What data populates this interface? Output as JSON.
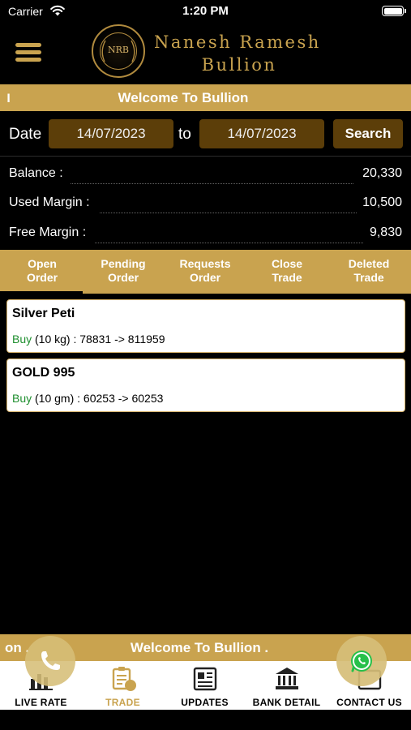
{
  "status": {
    "carrier": "Carrier",
    "time": "1:20 PM"
  },
  "brand": {
    "monogram": "NRB",
    "line1": "Nanesh Ramesh",
    "line2": "Bullion"
  },
  "ticker_top": {
    "fragment": "ו",
    "text": "Welcome To Bullion"
  },
  "filter": {
    "date_label": "Date",
    "from_date": "14/07/2023",
    "to_label": "to",
    "to_date": "14/07/2023",
    "search_label": "Search"
  },
  "account": {
    "balance_label": "Balance :",
    "balance_value": "20,330",
    "used_margin_label": "Used Margin :",
    "used_margin_value": "10,500",
    "free_margin_label": "Free Margin :",
    "free_margin_value": "9,830"
  },
  "order_tabs": [
    {
      "line1": "Open",
      "line2": "Order",
      "active": true
    },
    {
      "line1": "Pending",
      "line2": "Order"
    },
    {
      "line1": "Requests",
      "line2": "Order"
    },
    {
      "line1": "Close",
      "line2": "Trade"
    },
    {
      "line1": "Deleted",
      "line2": "Trade"
    }
  ],
  "orders": [
    {
      "name": "Silver Peti",
      "side": "Buy",
      "detail": " (10 kg) : 78831 -> 811959"
    },
    {
      "name": "GOLD 995",
      "side": "Buy",
      "detail": " (10 gm) : 60253 -> 60253"
    }
  ],
  "ticker_bottom": {
    "fragment": "on .",
    "text": "Welcome To Bullion ."
  },
  "tabbar": [
    {
      "label": "LIVE RATE",
      "icon": "chart-icon"
    },
    {
      "label": "TRADE",
      "icon": "trade-document-icon",
      "active": true
    },
    {
      "label": "UPDATES",
      "icon": "newspaper-icon"
    },
    {
      "label": "BANK DETAIL",
      "icon": "bank-icon"
    },
    {
      "label": "CONTACT US",
      "icon": "contact-icon"
    }
  ],
  "colors": {
    "gold": "#c9a34f",
    "field_brown": "#5c3e09",
    "buy_green": "#1f8f2f"
  }
}
